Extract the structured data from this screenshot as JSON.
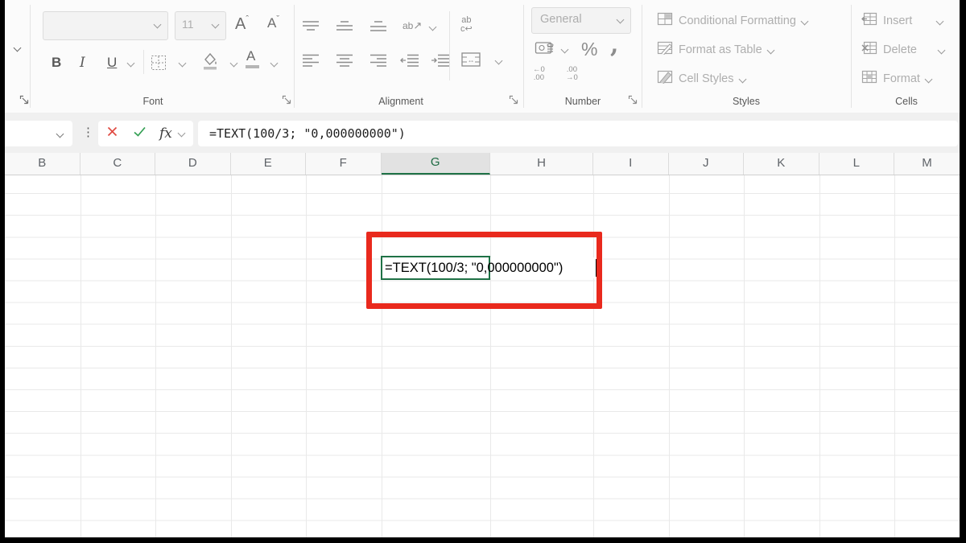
{
  "ribbon": {
    "font": {
      "label": "Font",
      "size": "11",
      "bold": "B",
      "italic": "I",
      "underline": "U",
      "grow": "A",
      "shrink": "A",
      "color_letter": "A"
    },
    "alignment": {
      "label": "Alignment",
      "orientation_text": "ab",
      "wrap_top": "ab",
      "wrap_bottom": "c"
    },
    "number": {
      "label": "Number",
      "format": "General",
      "percent": "%",
      "comma": ",",
      "inc_top": "←0",
      "inc_bottom": ".00",
      "dec_top": ".00",
      "dec_bottom": "→0"
    },
    "styles": {
      "label": "Styles",
      "conditional": "Conditional Formatting",
      "format_table": "Format as Table",
      "cell_styles": "Cell Styles"
    },
    "cells": {
      "label": "Cells",
      "insert": "Insert",
      "delete": "Delete",
      "format": "Format"
    }
  },
  "icons": {
    "orientation_arrow": "↗",
    "wrap_arrow": "↩",
    "merge_arrow": "↔"
  },
  "formula_bar": {
    "fx": "fx",
    "formula": "=TEXT(100/3; \"0,000000000\")"
  },
  "grid": {
    "columns": [
      "B",
      "C",
      "D",
      "E",
      "F",
      "G",
      "H",
      "I",
      "J",
      "K",
      "L",
      "M"
    ],
    "selected_column": "G",
    "editing_cell_text": "=TEXT(100/3; \"0,000000000\")"
  },
  "colors": {
    "annotation_red": "#e9291d",
    "selection_green": "#1f7246",
    "cancel_red": "#e04a42",
    "confirm_green": "#35a055",
    "header_selected_text": "#1c6a42"
  }
}
